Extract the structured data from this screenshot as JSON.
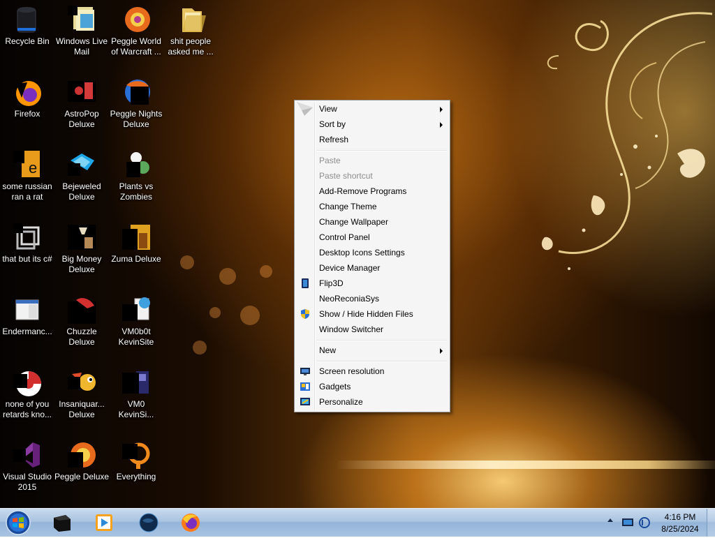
{
  "desktop_icons": [
    {
      "label_1": "Recycle Bin",
      "label_2": "",
      "icon": "recycle-bin-icon"
    },
    {
      "label_1": "Windows Live",
      "label_2": "Mail",
      "icon": "windows-live-mail-icon"
    },
    {
      "label_1": "Peggle World",
      "label_2": "of Warcraft ...",
      "icon": "peggle-world-of-warcraft-icon"
    },
    {
      "label_1": "shit people",
      "label_2": "asked me ...",
      "icon": "folder-icon"
    },
    {
      "label_1": "Firefox",
      "label_2": "",
      "icon": "firefox-icon"
    },
    {
      "label_1": "AstroPop",
      "label_2": "Deluxe",
      "icon": "astropop-deluxe-icon"
    },
    {
      "label_1": "Peggle Nights",
      "label_2": "Deluxe",
      "icon": "peggle-nights-icon"
    },
    {
      "label_1": "some russian",
      "label_2": "ran a rat",
      "icon": "document-icon"
    },
    {
      "label_1": "Bejeweled",
      "label_2": "Deluxe",
      "icon": "bejeweled-icon"
    },
    {
      "label_1": "Plants vs",
      "label_2": "Zombies",
      "icon": "plants-vs-zombies-icon"
    },
    {
      "label_1": "that but its c#",
      "label_2": "",
      "icon": "shortcut-icon"
    },
    {
      "label_1": "Big Money",
      "label_2": "Deluxe",
      "icon": "big-money-icon"
    },
    {
      "label_1": "Zuma Deluxe",
      "label_2": "",
      "icon": "zuma-deluxe-icon"
    },
    {
      "label_1": "Endermanc...",
      "label_2": "",
      "icon": "window-icon"
    },
    {
      "label_1": "Chuzzle",
      "label_2": "Deluxe",
      "icon": "chuzzle-icon"
    },
    {
      "label_1": "VM0b0t",
      "label_2": "KevinSite",
      "icon": "vm0b0t-icon"
    },
    {
      "label_1": "none of you",
      "label_2": "retards kno...",
      "icon": "chrome-icon"
    },
    {
      "label_1": "Insaniquar...",
      "label_2": "Deluxe",
      "icon": "insaniquarium-icon"
    },
    {
      "label_1": "VM0",
      "label_2": "KevinSi...",
      "icon": "vm0-icon"
    },
    {
      "label_1": "Visual Studio",
      "label_2": "2015",
      "icon": "visual-studio-icon"
    },
    {
      "label_1": "Peggle Deluxe",
      "label_2": "",
      "icon": "peggle-deluxe-icon"
    },
    {
      "label_1": "Everything",
      "label_2": "",
      "icon": "everything-search-icon"
    }
  ],
  "context_menu": {
    "view": "View",
    "sort_by": "Sort by",
    "refresh": "Refresh",
    "paste": "Paste",
    "paste_shortcut": "Paste shortcut",
    "add_remove_programs": "Add-Remove Programs",
    "change_theme": "Change Theme",
    "change_wallpaper": "Change Wallpaper",
    "control_panel": "Control Panel",
    "desktop_icons_settings": "Desktop Icons Settings",
    "device_manager": "Device Manager",
    "flip3d": "Flip3D",
    "neoreconiasys": "NeoReconiaSys",
    "show_hide_hidden_files": "Show / Hide Hidden Files",
    "window_switcher": "Window Switcher",
    "new": "New",
    "screen_resolution": "Screen resolution",
    "gadgets": "Gadgets",
    "personalize": "Personalize"
  },
  "taskbar": {
    "pinned": [
      "terminal-icon",
      "media-player-icon",
      "globe-icon",
      "firefox-icon"
    ],
    "clock_time": "4:16 PM",
    "clock_date": "8/25/2024"
  }
}
